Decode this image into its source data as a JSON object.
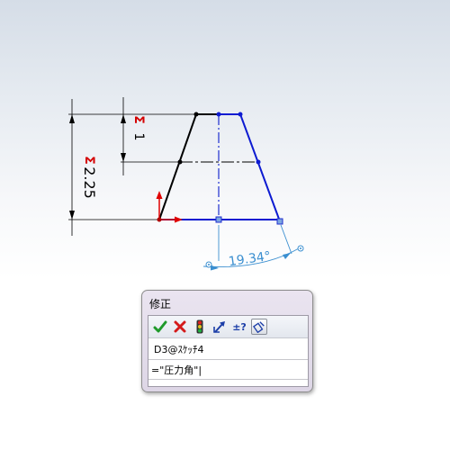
{
  "sketch": {
    "dimensions": {
      "total_height": {
        "value": "2.25",
        "symbol": "Σ"
      },
      "upper_height": {
        "value": "1",
        "symbol": "Σ"
      },
      "angle": {
        "value": "19.34°"
      }
    }
  },
  "dialog": {
    "title": "修正",
    "toolbar": {
      "ok": "ok-check-icon",
      "cancel": "cancel-x-icon",
      "rebuild": "rebuild-traffic-light-icon",
      "reverse": "reverse-direction-icon",
      "tolerance": "±?",
      "mark_for_drawing": "mark-dimension-icon"
    },
    "dimension_name": "D3@ｽｹｯﾁ4",
    "value": "=\"圧力角\"|"
  },
  "colors": {
    "sketch_blue": "#0d1bd1",
    "sketch_black": "#000000",
    "centerline": "#1f2fcf",
    "angle_dim": "#3b8fd0",
    "sigma_red": "#d40000"
  }
}
